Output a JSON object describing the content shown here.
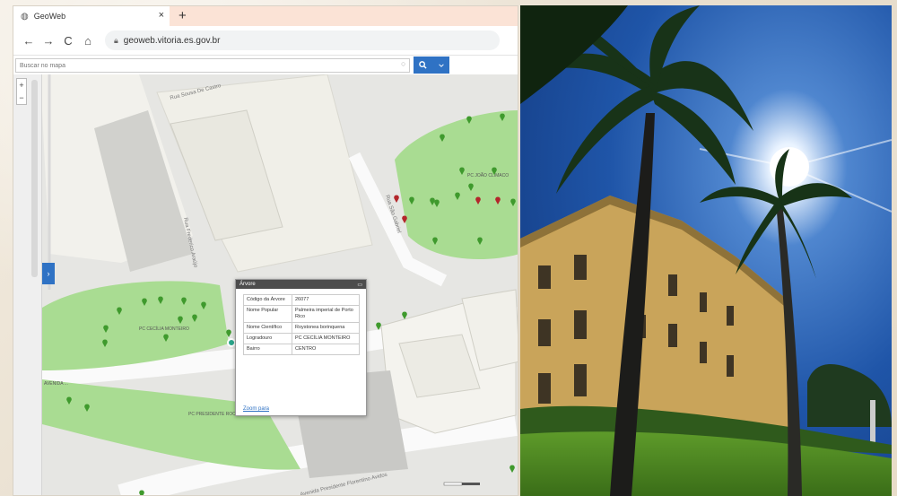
{
  "browser": {
    "tab_title": "GeoWeb",
    "tab_close": "×",
    "new_tab": "+",
    "nav": {
      "back": "←",
      "forward": "→",
      "reload": "C",
      "home": "⌂"
    },
    "url": "geoweb.vitoria.es.gov.br"
  },
  "search": {
    "placeholder": "Buscar no mapa",
    "button_icon": "search-icon",
    "dropdown_icon": "chevron-down-icon"
  },
  "map": {
    "zoom_in": "+",
    "zoom_out": "−",
    "expand_label": "›",
    "street_labels": {
      "top": "Rua Sousa De Castro",
      "vertical": "Rua Frederico Araújo",
      "diagonal": "Rua São Gabriel",
      "bottom": "Avenida Presidente Florentino Avidos"
    },
    "place_labels": {
      "left_park": "PC CECÍLIA MONTEIRO",
      "bottom_park": "PC PRESIDENTE ROOSEVELT",
      "right_park": "PC JOÃO CLÍMACO",
      "far_left": "AVENIDA ..."
    },
    "colors": {
      "park": "#a9dc92",
      "pin_green": "#3f9a2d",
      "pin_red": "#b3262b",
      "popup_head": "#4d4d4d"
    }
  },
  "popup": {
    "title": "Árvore",
    "rows": [
      {
        "key": "Código da Árvore",
        "value": "26077"
      },
      {
        "key": "Nome Popular",
        "value": "Palmeira imperial de Porto Rico"
      },
      {
        "key": "Nome Científico",
        "value": "Roystonea borinquena"
      },
      {
        "key": "Logradouro",
        "value": "PC CECÍLIA MONTEIRO"
      },
      {
        "key": "Bairro",
        "value": "CENTRO"
      }
    ],
    "zoom_link": "Zoom para"
  }
}
